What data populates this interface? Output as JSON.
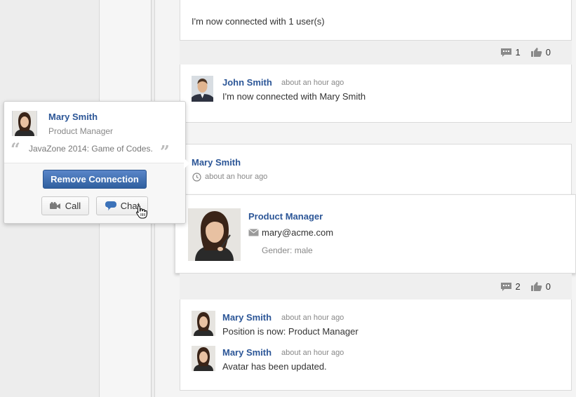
{
  "feed": {
    "top_post": {
      "text": "I'm now connected with 1 user(s)",
      "comments": "1",
      "likes": "0"
    },
    "john_entry": {
      "name": "John Smith",
      "time": "about an hour ago",
      "text": "I'm now connected with Mary Smith"
    },
    "mary_post": {
      "name": "Mary Smith",
      "time": "about an hour ago",
      "comments": "2",
      "likes": "0"
    },
    "profile_tooltip": {
      "title": "Product Manager",
      "email": "mary@acme.com",
      "gender": "Gender: male"
    },
    "entries": [
      {
        "name": "Mary Smith",
        "time": "about an hour ago",
        "text": "Position is now: Product Manager"
      },
      {
        "name": "Mary Smith",
        "time": "about an hour ago",
        "text": "Avatar has been updated."
      }
    ]
  },
  "popover": {
    "name": "Mary Smith",
    "title": "Product Manager",
    "quote": "JavaZone 2014: Game of Codes.",
    "remove_label": "Remove Connection",
    "call_label": "Call",
    "chat_label": "Chat"
  },
  "colors": {
    "link": "#2c5697",
    "primary_button": "#3d6db5"
  }
}
